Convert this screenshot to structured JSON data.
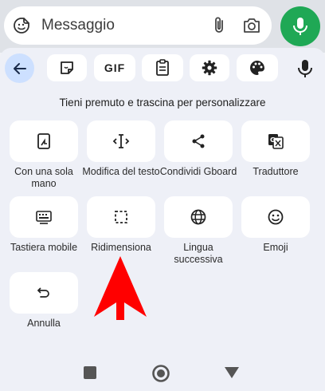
{
  "message_bar": {
    "placeholder": "Messaggio",
    "icons": [
      "sticker-emoji-icon",
      "paperclip-icon",
      "camera-icon",
      "microphone-icon"
    ],
    "fab_color": "#1fa855"
  },
  "toolbar": {
    "gif_label": "GIF",
    "icons": [
      "back-arrow-icon",
      "sticker-icon",
      "gif-icon",
      "clipboard-icon",
      "settings-gear-icon",
      "theme-palette-icon",
      "microphone-icon"
    ]
  },
  "hint": "Tieni premuto e trascina per personalizzare",
  "tiles": [
    {
      "label": "Con una sola mano",
      "icon": "one-handed-icon"
    },
    {
      "label": "Modifica del testo",
      "icon": "text-cursor-icon"
    },
    {
      "label": "Condividi Gboard",
      "icon": "share-icon"
    },
    {
      "label": "Traduttore",
      "icon": "translate-icon"
    },
    {
      "label": "Tastiera mobile",
      "icon": "floating-keyboard-icon"
    },
    {
      "label": "Ridimensiona",
      "icon": "resize-icon"
    },
    {
      "label": "Lingua successiva",
      "icon": "globe-icon"
    },
    {
      "label": "Emoji",
      "icon": "emoji-icon"
    },
    {
      "label": "Annulla",
      "icon": "undo-icon"
    }
  ],
  "annotation": {
    "icon": "red-arrow-icon",
    "color": "#ff0000"
  },
  "navbar": {
    "icons": [
      "recents-square-icon",
      "home-circle-icon",
      "back-triangle-icon"
    ]
  }
}
